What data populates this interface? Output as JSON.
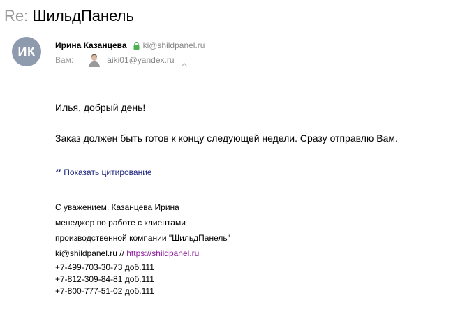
{
  "subject": {
    "prefix": "Re:",
    "title": "ШильдПанель"
  },
  "sender": {
    "initials": "ИК",
    "name": "Ирина Казанцева",
    "email": "ki@shildpanel.ru"
  },
  "recipient": {
    "label": "Вам:",
    "email": "aiki01@yandex.ru"
  },
  "message": {
    "greeting": "Илья, добрый день!",
    "body": "Заказ должен быть готов к концу следующей недели. Сразу отправлю Вам."
  },
  "quote_toggle": {
    "icon_text": "”",
    "label": "Показать цитирование"
  },
  "signature": {
    "line1": "С уважением, Казанцева Ирина",
    "line2": "менеджер по работе с клиентами",
    "line3": "производственной компании \"ШильдПанель\"",
    "email": "ki@shildpanel.ru",
    "separator": " // ",
    "website": "https://shildpanel.ru",
    "phones": [
      "+7-499-703-30-73 доб.111",
      "+7-812-309-84-81 доб.111",
      "+7-800-777-51-02 доб.111"
    ]
  },
  "colors": {
    "avatar_bg": "#8e9aad",
    "secure_lock": "#4caf50",
    "quote_link": "#1a237e",
    "website_link": "#8b1a9b"
  },
  "icons": {
    "lock": "lock-icon",
    "chevron": "chevron-up-icon",
    "quote": "quote-icon"
  }
}
